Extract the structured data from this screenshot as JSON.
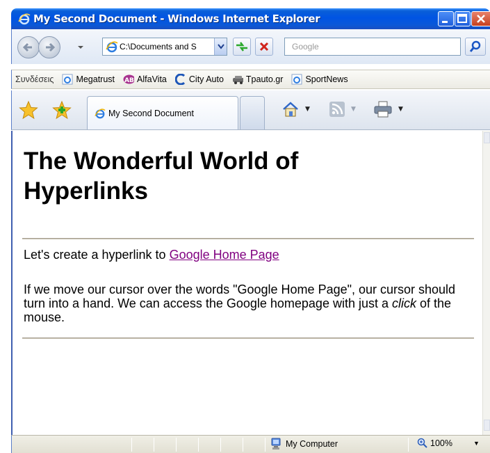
{
  "window": {
    "title": "My Second Document - Windows Internet Explorer"
  },
  "navigation": {
    "address_value": "C:\\Documents and S",
    "search_placeholder": "Google"
  },
  "links_bar": {
    "label": "Συνδέσεις",
    "items": [
      {
        "label": "Megatrust",
        "icon": "ie-page-icon"
      },
      {
        "label": "AlfaVita",
        "icon": "ab-logo-icon"
      },
      {
        "label": "City Auto",
        "icon": "c-logo-icon"
      },
      {
        "label": "Tpauto.gr",
        "icon": "car-icon"
      },
      {
        "label": "SportNews",
        "icon": "ie-page-icon"
      }
    ]
  },
  "tabs": [
    {
      "label": "My Second Document",
      "active": true
    }
  ],
  "page": {
    "heading": "The Wonderful World of Hyperlinks",
    "intro_text": "Let's create a hyperlink to ",
    "link_text": "Google Home Page",
    "para_before_em": "If we move our cursor over the words \"Google Home Page\", our cursor should turn into a hand. We can access the Google homepage with just a ",
    "para_em": "click",
    "para_after_em": " of the mouse."
  },
  "status_bar": {
    "zone": "My Computer",
    "zoom": "100%"
  },
  "colors": {
    "title_bar": "#0054e3",
    "visited_link": "#800080"
  }
}
